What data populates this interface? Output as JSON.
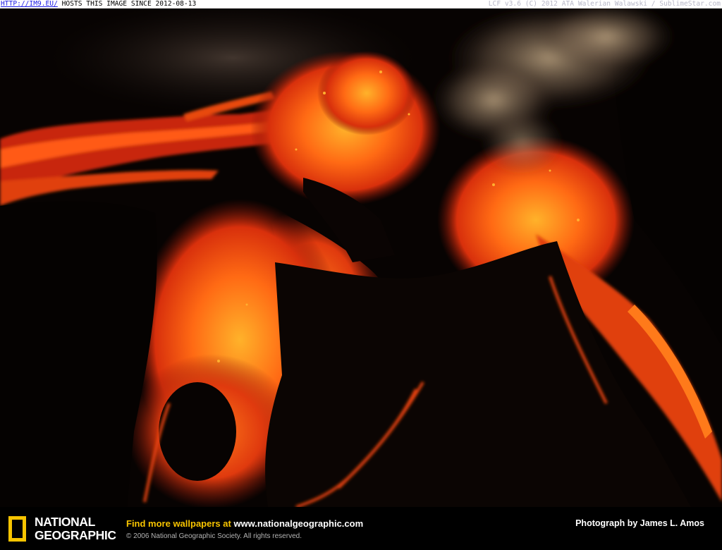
{
  "top_bar": {
    "link_text": "HTTP://IM9.EU/",
    "host_text": " HOSTS THIS IMAGE SINCE 2012-08-13",
    "right_text": "LCF v3.6 (C) 2012 ATA Walerian Walawski / SublimeStar.com"
  },
  "footer": {
    "logo_line1": "NATIONAL",
    "logo_line2": "GEOGRAPHIC",
    "promo_prefix": "Find more wallpapers at ",
    "promo_url": "www.nationalgeographic.com",
    "copyright": "© 2006 National Geographic Society. All rights reserved.",
    "credit": "Photograph by James L. Amos"
  },
  "colors": {
    "logo_yellow": "#f7c400",
    "lava_bright": "#ff9a1a",
    "lava_mid": "#f04a0e",
    "lava_deep": "#a8180a",
    "rock": "#0a0403",
    "smoke": "#b49876"
  }
}
